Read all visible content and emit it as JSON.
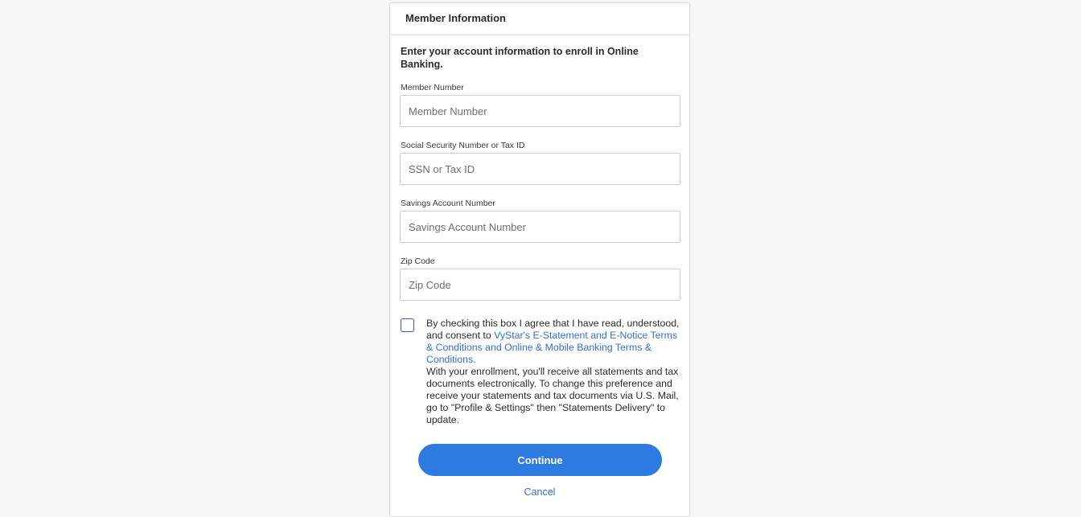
{
  "card": {
    "title": "Member Information",
    "intro": "Enter your account information to enroll in Online Banking."
  },
  "fields": [
    {
      "label": "Member Number",
      "placeholder": "Member Number",
      "value": ""
    },
    {
      "label": "Social Security Number or Tax ID",
      "placeholder": "SSN or Tax ID",
      "value": ""
    },
    {
      "label": "Savings Account Number",
      "placeholder": "Savings Account Number",
      "value": ""
    },
    {
      "label": "Zip Code",
      "placeholder": "Zip Code",
      "value": ""
    }
  ],
  "consent": {
    "checked": false,
    "text_before": "By checking this box I agree that I have read, understood, and consent to ",
    "link_text": "VyStar's E-Statement and E-Notice Terms & Conditions and Online & Mobile Banking Terms & Conditions.",
    "text_after": "With your enrollment, you'll receive all statements and tax documents electronically. To change this preference and receive your statements and tax documents via U.S. Mail, go to \"Profile & Settings\" then \"Statements Delivery\" to update."
  },
  "actions": {
    "continue_label": "Continue",
    "cancel_label": "Cancel"
  },
  "colors": {
    "accent": "#2d7ae0",
    "link": "#2f6fd6",
    "background": "#f7f7f7"
  }
}
